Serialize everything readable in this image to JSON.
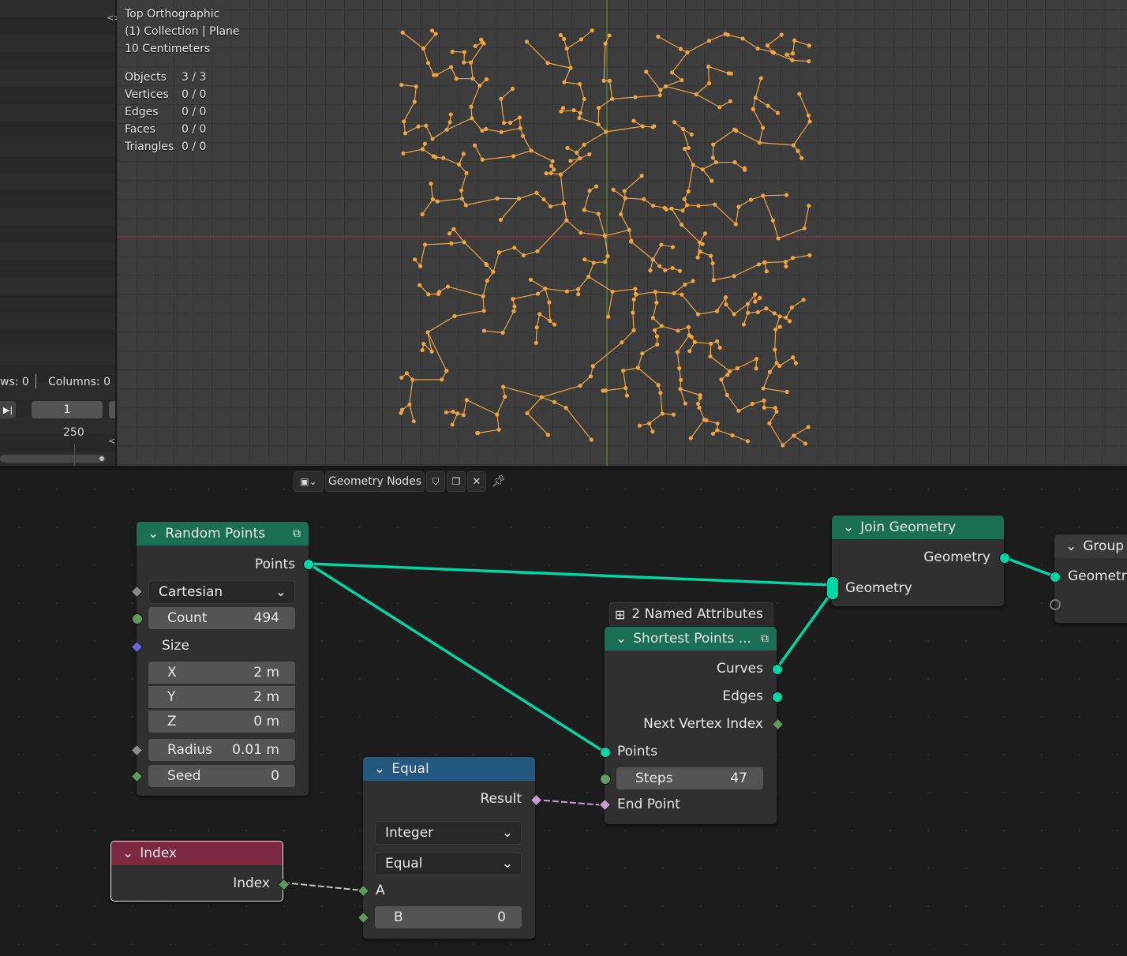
{
  "overlay": {
    "view": "Top Orthographic",
    "collection": "(1) Collection | Plane",
    "scale": "10 Centimeters",
    "stats": [
      {
        "label": "Objects",
        "value": "3 / 3"
      },
      {
        "label": "Vertices",
        "value": "0 / 0"
      },
      {
        "label": "Edges",
        "value": "0 / 0"
      },
      {
        "label": "Faces",
        "value": "0 / 0"
      },
      {
        "label": "Triangles",
        "value": "0 / 0"
      }
    ]
  },
  "left_panel": {
    "rows_text": "ws: 0",
    "columns_text": "Columns: 0",
    "frame_current": "1",
    "frame_end": "250"
  },
  "header": {
    "title": "Geometry Nodes"
  },
  "nodes": {
    "random_points": {
      "title": "Random Points",
      "output": "Points",
      "mode": "Cartesian",
      "count_label": "Count",
      "count_value": "494",
      "size_label": "Size",
      "x_label": "X",
      "x_value": "2 m",
      "y_label": "Y",
      "y_value": "2 m",
      "z_label": "Z",
      "z_value": "0 m",
      "radius_label": "Radius",
      "radius_value": "0.01 m",
      "seed_label": "Seed",
      "seed_value": "0"
    },
    "join_geometry": {
      "title": "Join Geometry",
      "output": "Geometry",
      "input": "Geometry"
    },
    "group_output": {
      "title": "Group",
      "input": "Geometry"
    },
    "shortest_points": {
      "badge": "2 Named Attributes",
      "title": "Shortest Points ...",
      "out_curves": "Curves",
      "out_edges": "Edges",
      "out_next": "Next Vertex Index",
      "in_points": "Points",
      "steps_label": "Steps",
      "steps_value": "47",
      "in_end": "End Point"
    },
    "equal": {
      "title": "Equal",
      "output": "Result",
      "type": "Integer",
      "operation": "Equal",
      "in_a": "A",
      "b_label": "B",
      "b_value": "0"
    },
    "index": {
      "title": "Index",
      "output": "Index"
    }
  },
  "colors": {
    "geometry_socket": "#00d6a3",
    "geometry_header": "#1c6f57",
    "converter_header": "#24587e",
    "input_header": "#7d2941",
    "vertex_color": "#f0a341",
    "x_axis": "#a8343d",
    "y_axis": "#5f9a2a"
  }
}
